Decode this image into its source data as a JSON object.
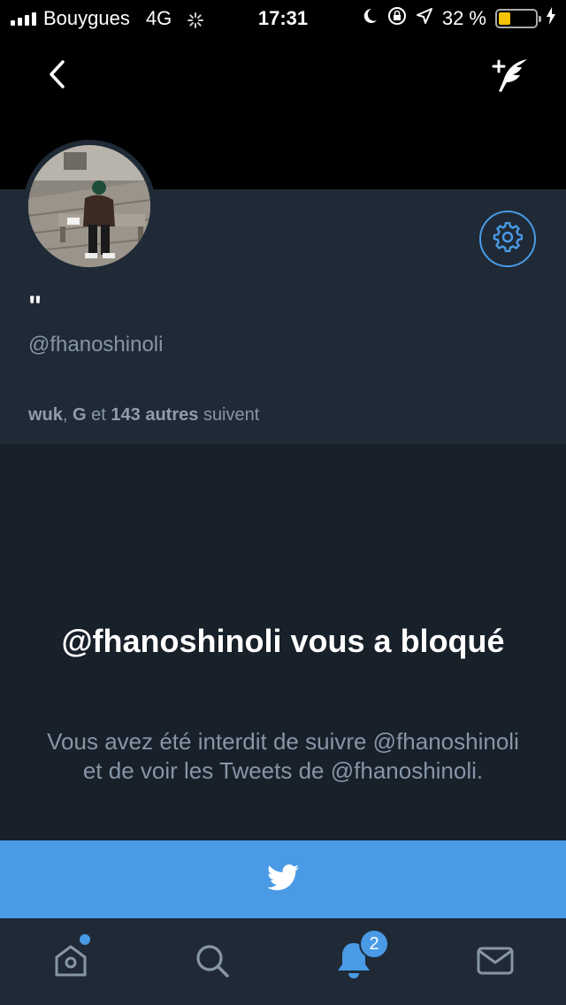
{
  "status_bar": {
    "carrier": "Bouygues",
    "network": "4G",
    "time": "17:31",
    "battery_percent": "32 %",
    "battery_level": 0.32,
    "battery_color": "#f5c400"
  },
  "header": {
    "back_icon": "chevron-left-icon",
    "compose_icon": "compose-tweet-icon"
  },
  "profile": {
    "display_name": "\"",
    "handle": "@fhanoshinoli",
    "followers_name1": "wuk",
    "followers_sep": ",",
    "followers_name2": "G",
    "followers_and": "et",
    "followers_others": "143 autres",
    "followers_suffix": "suivent",
    "settings_icon": "gear-icon"
  },
  "blocked": {
    "title": "@fhanoshinoli vous a bloqué",
    "description": "Vous avez été interdit de suivre @fhanoshinoli et de voir les Tweets de @fhanoshinoli."
  },
  "tab_bar": {
    "items": [
      {
        "icon": "home-icon",
        "has_dot": true
      },
      {
        "icon": "search-icon"
      },
      {
        "icon": "bell-icon",
        "active": true,
        "badge": "2"
      },
      {
        "icon": "mail-icon"
      }
    ]
  },
  "colors": {
    "accent": "#4a9ae6",
    "profile_bg": "#1f2a36",
    "blocked_bg": "#18202a",
    "muted_text": "#8696a6"
  }
}
